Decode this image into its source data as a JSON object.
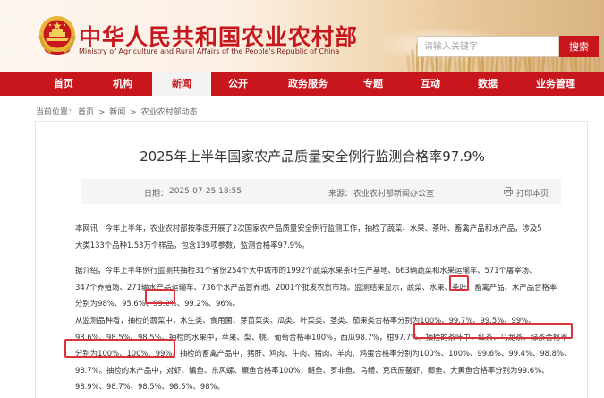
{
  "header": {
    "site_title": "中华人民共和国农业农村部",
    "site_subtitle": "Ministry of Agriculture and Rural Affairs of the People's Republic of China",
    "search_placeholder": "请输入关键字",
    "search_button": "搜索"
  },
  "nav": {
    "items": [
      "首页",
      "机构",
      "新闻",
      "公开",
      "政务服务",
      "专题",
      "互动",
      "数据",
      "业务管理"
    ],
    "active": "新闻"
  },
  "breadcrumb": {
    "prefix": "当前位置：",
    "items": [
      "首页",
      "新闻",
      "农业农村部动态"
    ],
    "separator": " > "
  },
  "article": {
    "title": "2025年上半年国家农产品质量安全例行监测合格率97.9%",
    "date_label": "日期：",
    "date": "2025-07-25 18:55",
    "source_label": "来源：",
    "source": "农业农村部新闻办公室",
    "print_label": "打印本页",
    "paragraphs": [
      [
        "本网讯　今年上半年，农业农村部按季度开展了2次国家农产品质量安全例行监测工作，抽检了蔬菜、水果、茶叶、畜禽产品和水产品，涉及5",
        "大类133个品种1.53万个样品，包含139项参数，监测合格率97.9%。"
      ],
      [
        "据介绍，今年上半年例行监测共抽检31个省份254个大中城市的1992个蔬菜水果茶叶生产基地、663辆蔬菜和水果运输车、571个屠宰场、",
        "347个养殖场、271辆水产品运输车、736个水产品暂养池、2001个批发农贸市场。监测结果显示，蔬菜、水果、茶叶、畜禽产品、水产品合格率",
        "分别为98%、95.6%、99.2%、99.2%、96%。"
      ],
      [
        "从监测品种看，抽检的蔬菜中，水生类、食用菌、芽苗菜类、瓜类、叶菜类、茎类、茄果类合格率分别为100%、99.7%、99.5%、99%、",
        "98.6%、98.5%、98.5%。抽检的水果中，苹果、梨、桃、葡萄合格率100%，西瓜98.7%，柑97.7%。抽检的茶叶中，红茶、乌龙茶、绿茶合格率",
        "分别为100%、100%、99%。抽检的畜禽产品中，猪肝、鸡肉、牛肉、猪肉、羊肉、鸡蛋合格率分别为100%、100%、99.6%、99.4%、98.8%、",
        "98.7%。抽检的水产品中，对虾、鳊鱼、东风螺、鳜鱼合格率100%，鲢鱼、罗非鱼、乌鳢、克氏原鳌虾、鲫鱼、大黄鱼合格率分别为99.6%、",
        "98.9%、98.7%、98.5%、98.5%、98%。"
      ]
    ]
  },
  "colors": {
    "brand_red": "#c8161d",
    "highlight_red": "#d9323b"
  },
  "icons": {
    "emblem": "national-emblem-icon",
    "print": "printer-icon"
  }
}
